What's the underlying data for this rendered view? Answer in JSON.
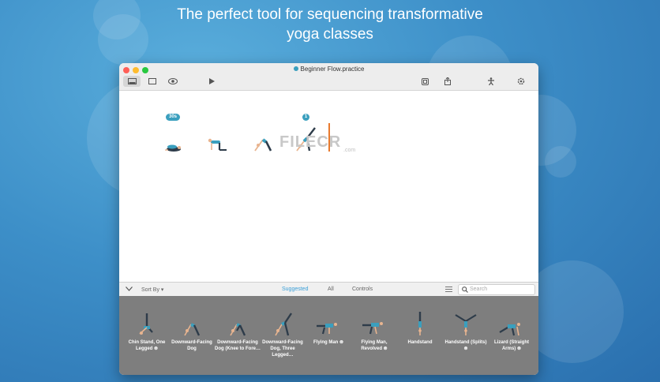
{
  "headline": {
    "line1": "The perfect tool for sequencing transformative",
    "line2": "yoga classes"
  },
  "window": {
    "title": "Beginner Flow.practice",
    "toolbar": {
      "left_icons": [
        "sidebar-icon",
        "square-icon",
        "eye-icon",
        "play-icon"
      ],
      "right_icons": [
        "export-icon",
        "share-icon",
        "figure-icon",
        "settings-icon"
      ]
    }
  },
  "timeline": {
    "duration_badge": "30s",
    "count_badge": "1",
    "poses": [
      "child-pose",
      "tabletop-pose",
      "downward-dog-pose",
      "downward-dog-leg-pose"
    ]
  },
  "watermark": {
    "text": "FILECR",
    "sub": ".com"
  },
  "filterbar": {
    "sort_label": "Sort By",
    "tabs": [
      "Suggested",
      "All",
      "Controls"
    ],
    "active_tab": "Suggested",
    "search_placeholder": "Search",
    "accent_color": "#3a9fd8"
  },
  "library": {
    "poses": [
      {
        "label": "Chin Stand, One Legged ⊗"
      },
      {
        "label": "Downward-Facing Dog"
      },
      {
        "label": "Downward-Facing Dog (Knee to Fore…"
      },
      {
        "label": "Downward-Facing Dog, Three Legged…"
      },
      {
        "label": "Flying Man ⊗"
      },
      {
        "label": "Flying Man, Revolved ⊗"
      },
      {
        "label": "Handstand"
      },
      {
        "label": "Handstand (Splits) ⊗"
      },
      {
        "label": "Lizard (Straight Arms) ⊗"
      }
    ]
  }
}
